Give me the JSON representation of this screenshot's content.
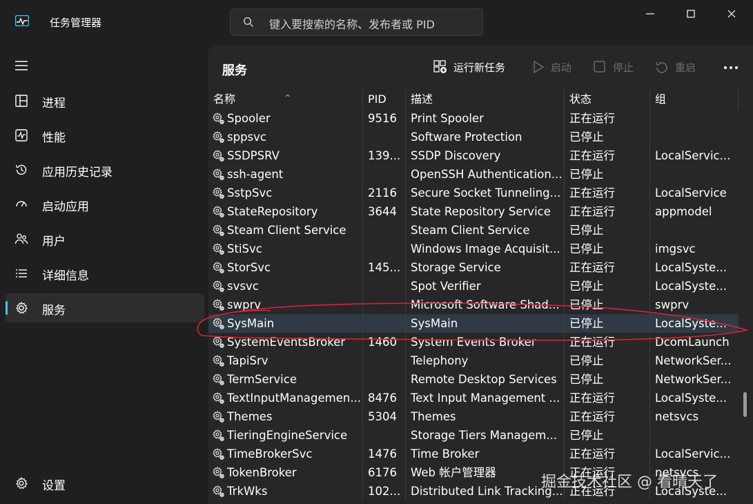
{
  "app": {
    "title": "任务管理器"
  },
  "search": {
    "placeholder": "键入要搜索的名称、发布者或 PID"
  },
  "sidebar": {
    "items": [
      {
        "label": "进程",
        "icon": "processes-icon",
        "active": false
      },
      {
        "label": "性能",
        "icon": "performance-icon",
        "active": false
      },
      {
        "label": "应用历史记录",
        "icon": "history-icon",
        "active": false
      },
      {
        "label": "启动应用",
        "icon": "startup-icon",
        "active": false
      },
      {
        "label": "用户",
        "icon": "users-icon",
        "active": false
      },
      {
        "label": "详细信息",
        "icon": "details-icon",
        "active": false
      },
      {
        "label": "服务",
        "icon": "services-icon",
        "active": true
      }
    ],
    "settings_label": "设置"
  },
  "main": {
    "title": "服务",
    "toolbar": {
      "new_task": "运行新任务",
      "start": "启动",
      "stop": "停止",
      "restart": "重启"
    }
  },
  "table": {
    "columns": {
      "name": "名称",
      "pid": "PID",
      "desc": "描述",
      "status": "状态",
      "group": "组"
    },
    "rows": [
      {
        "name": "Spooler",
        "pid": "9516",
        "desc": "Print Spooler",
        "status": "正在运行",
        "group": ""
      },
      {
        "name": "sppsvc",
        "pid": "",
        "desc": "Software Protection",
        "status": "已停止",
        "group": ""
      },
      {
        "name": "SSDPSRV",
        "pid": "139...",
        "desc": "SSDP Discovery",
        "status": "正在运行",
        "group": "LocalServic..."
      },
      {
        "name": "ssh-agent",
        "pid": "",
        "desc": "OpenSSH Authentication...",
        "status": "已停止",
        "group": ""
      },
      {
        "name": "SstpSvc",
        "pid": "2116",
        "desc": "Secure Socket Tunneling...",
        "status": "正在运行",
        "group": "LocalService"
      },
      {
        "name": "StateRepository",
        "pid": "3644",
        "desc": "State Repository Service",
        "status": "正在运行",
        "group": "appmodel"
      },
      {
        "name": "Steam Client Service",
        "pid": "",
        "desc": "Steam Client Service",
        "status": "已停止",
        "group": ""
      },
      {
        "name": "StiSvc",
        "pid": "",
        "desc": "Windows Image Acquisit...",
        "status": "已停止",
        "group": "imgsvc"
      },
      {
        "name": "StorSvc",
        "pid": "145...",
        "desc": "Storage Service",
        "status": "正在运行",
        "group": "LocalSyste..."
      },
      {
        "name": "svsvc",
        "pid": "",
        "desc": "Spot Verifier",
        "status": "已停止",
        "group": "LocalSyste..."
      },
      {
        "name": "swprv",
        "pid": "",
        "desc": "Microsoft Software Shad...",
        "status": "已停止",
        "group": "swprv"
      },
      {
        "name": "SysMain",
        "pid": "",
        "desc": "SysMain",
        "status": "已停止",
        "group": "LocalSyste..."
      },
      {
        "name": "SystemEventsBroker",
        "pid": "1460",
        "desc": "System Events Broker",
        "status": "正在运行",
        "group": "DcomLaunch"
      },
      {
        "name": "TapiSrv",
        "pid": "",
        "desc": "Telephony",
        "status": "已停止",
        "group": "NetworkSer..."
      },
      {
        "name": "TermService",
        "pid": "",
        "desc": "Remote Desktop Services",
        "status": "已停止",
        "group": "NetworkSer..."
      },
      {
        "name": "TextInputManagemen...",
        "pid": "8476",
        "desc": "Text Input Management ...",
        "status": "正在运行",
        "group": "LocalSyste..."
      },
      {
        "name": "Themes",
        "pid": "5304",
        "desc": "Themes",
        "status": "正在运行",
        "group": "netsvcs"
      },
      {
        "name": "TieringEngineService",
        "pid": "",
        "desc": "Storage Tiers Managem...",
        "status": "已停止",
        "group": ""
      },
      {
        "name": "TimeBrokerSvc",
        "pid": "1476",
        "desc": "Time Broker",
        "status": "正在运行",
        "group": "LocalServic..."
      },
      {
        "name": "TokenBroker",
        "pid": "6176",
        "desc": "Web 帐户管理器",
        "status": "正在运行",
        "group": "netsvcs"
      },
      {
        "name": "TrkWks",
        "pid": "102...",
        "desc": "Distributed Link Tracking...",
        "status": "正在运行",
        "group": "LocalSyste..."
      }
    ]
  },
  "watermark": "掘金技术社区 @ 看晴天了",
  "colors": {
    "accent": "#4cc2ff",
    "annotation": "#e0203a",
    "background": "#1f1f1f",
    "panel": "#272727"
  }
}
